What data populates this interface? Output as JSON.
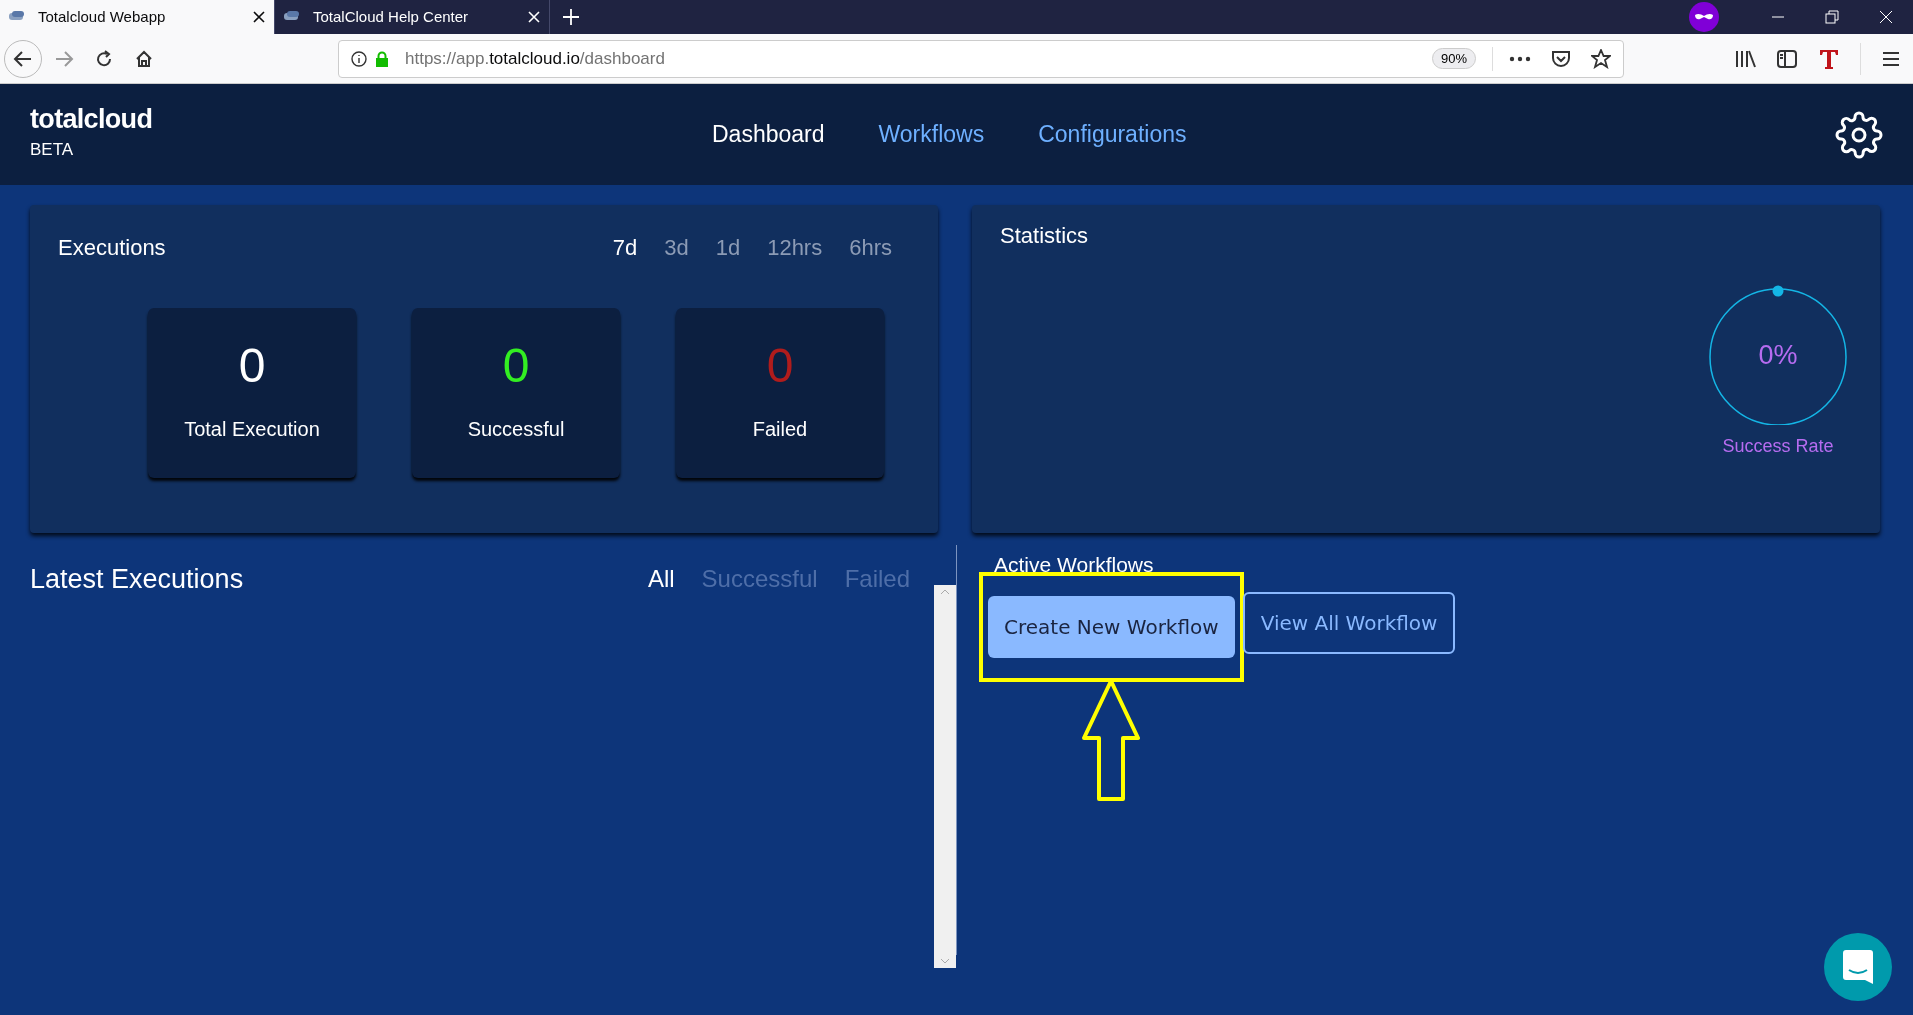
{
  "browser": {
    "tabs": [
      {
        "title": "Totalcloud Webapp",
        "selected": true
      },
      {
        "title": "TotalCloud Help Center",
        "selected": false
      }
    ],
    "url": {
      "prefix": "https://app.",
      "domain": "totalcloud.io",
      "path": "/dashboard"
    },
    "zoom": "90%"
  },
  "app": {
    "logo": "totalcloud",
    "badge": "BETA",
    "nav": [
      {
        "label": "Dashboard",
        "selected": true
      },
      {
        "label": "Workflows",
        "selected": false
      },
      {
        "label": "Configurations",
        "selected": false
      }
    ]
  },
  "executions": {
    "title": "Executions",
    "ranges": [
      {
        "label": "7d",
        "selected": true
      },
      {
        "label": "3d",
        "selected": false
      },
      {
        "label": "1d",
        "selected": false
      },
      {
        "label": "12hrs",
        "selected": false
      },
      {
        "label": "6hrs",
        "selected": false
      }
    ],
    "tiles": [
      {
        "value": "0",
        "label": "Total Execution",
        "color": "#ffffff"
      },
      {
        "value": "0",
        "label": "Successful",
        "color": "#33ee22"
      },
      {
        "value": "0",
        "label": "Failed",
        "color": "#b01c1c"
      }
    ]
  },
  "statistics": {
    "title": "Statistics",
    "rate": "0%",
    "rate_label": "Success Rate"
  },
  "latest_executions": {
    "title": "Latest Executions",
    "filters": [
      {
        "label": "All",
        "selected": true
      },
      {
        "label": "Successful",
        "selected": false
      },
      {
        "label": "Failed",
        "selected": false
      }
    ]
  },
  "active_workflows": {
    "title": "Active Workflows",
    "buttons": [
      {
        "label": "Create New Workflow",
        "kind": "filled",
        "highlighted": true
      },
      {
        "label": "View All Workflow",
        "kind": "outline",
        "highlighted": false
      }
    ]
  }
}
